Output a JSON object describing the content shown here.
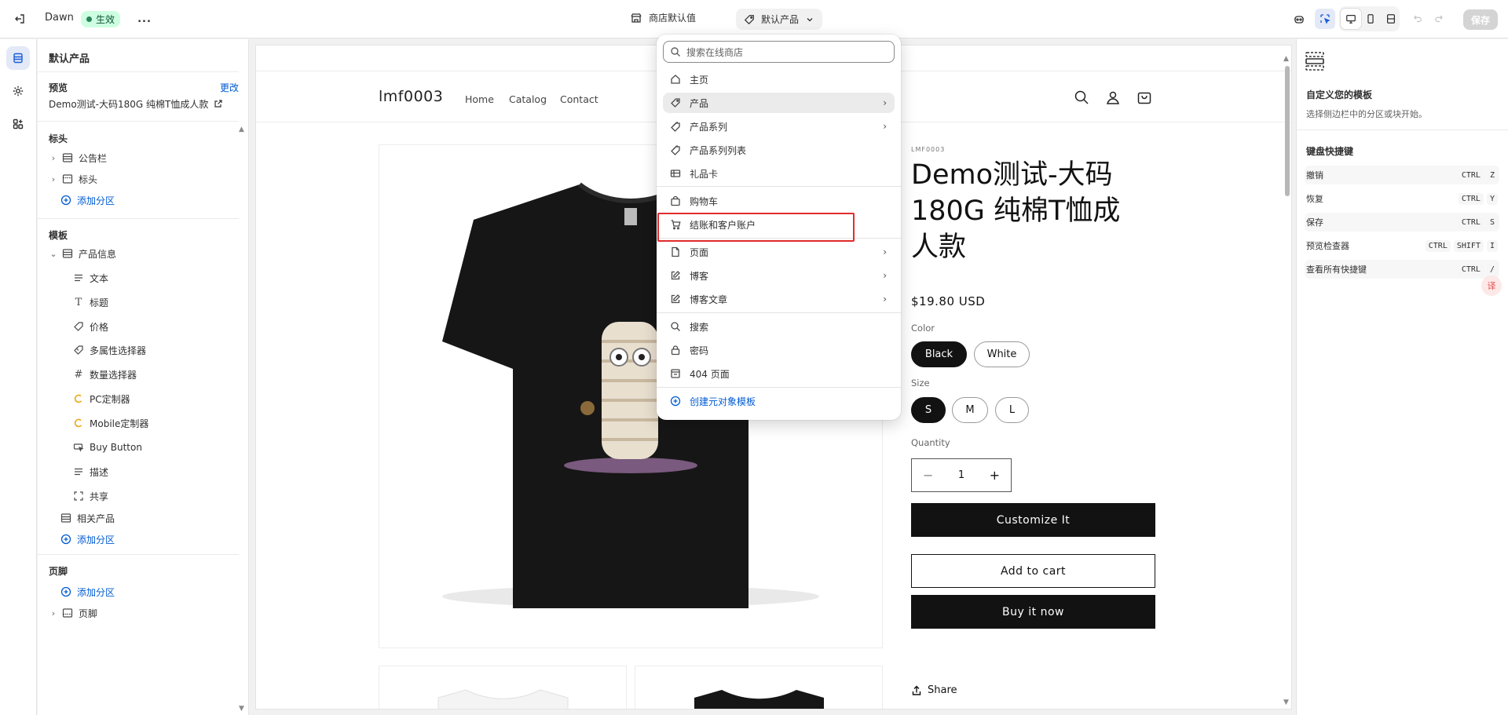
{
  "topbar": {
    "theme_name": "Dawn",
    "status_badge": "生效",
    "more_label": "...",
    "store_defaults": "商店默认值",
    "template_select": "默认产品",
    "save_label": "保存"
  },
  "left_panel": {
    "title": "默认产品",
    "preview_label": "预览",
    "change_link": "更改",
    "preview_product": "Demo测试-大码180G 纯棉T恤成人款",
    "header_section": "标头",
    "header_items": [
      "公告栏",
      "标头"
    ],
    "add_section": "添加分区",
    "template_section": "模板",
    "product_info": "产品信息",
    "blocks": [
      "文本",
      "标题",
      "价格",
      "多属性选择器",
      "数量选择器",
      "PC定制器",
      "Mobile定制器",
      "Buy Button",
      "描述",
      "共享"
    ],
    "related_products": "相关产品",
    "footer_section": "页脚",
    "footer_item": "页脚"
  },
  "store": {
    "logo": "lmf0003",
    "nav": [
      "Home",
      "Catalog",
      "Contact"
    ],
    "vendor": "LMF0003",
    "title": "Demo测试-大码180G 纯棉T恤成人款",
    "price": "$19.80 USD",
    "color_label": "Color",
    "colors": [
      "Black",
      "White"
    ],
    "size_label": "Size",
    "sizes": [
      "S",
      "M",
      "L"
    ],
    "quantity_label": "Quantity",
    "quantity_value": "1",
    "quantity_minus": "−",
    "quantity_plus": "+",
    "customize_btn": "Customize It",
    "add_to_cart": "Add to cart",
    "buy_now": "Buy it now",
    "share": "Share"
  },
  "dropdown": {
    "search_placeholder": "搜索在线商店",
    "items": [
      "主页",
      "产品",
      "产品系列",
      "产品系列列表",
      "礼品卡",
      "购物车",
      "结账和客户账户",
      "页面",
      "博客",
      "博客文章",
      "搜索",
      "密码",
      "404 页面"
    ],
    "create_metaobject": "创建元对象模板",
    "colors": {
      "highlight": "#ebebeb",
      "red_box": "#e12b2b"
    }
  },
  "right_panel": {
    "title": "自定义您的模板",
    "subtitle": "选择侧边栏中的分区或块开始。",
    "shortcuts_title": "键盘快捷键",
    "shortcuts": [
      {
        "label": "撤销",
        "k1": "CTRL",
        "k2": "Z",
        "k3": ""
      },
      {
        "label": "恢复",
        "k1": "CTRL",
        "k2": "Y",
        "k3": ""
      },
      {
        "label": "保存",
        "k1": "CTRL",
        "k2": "S",
        "k3": ""
      },
      {
        "label": "预览检查器",
        "k1": "CTRL",
        "k2": "SHIFT",
        "k3": "I"
      },
      {
        "label": "查看所有快捷键",
        "k1": "CTRL",
        "k2": "/",
        "k3": ""
      }
    ],
    "float_icon": "译"
  }
}
